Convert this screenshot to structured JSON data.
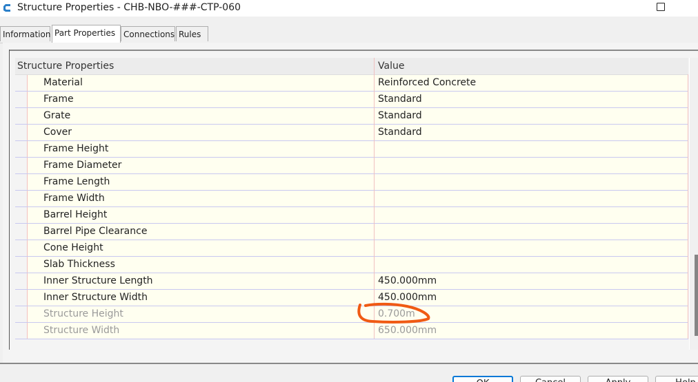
{
  "window": {
    "title": "Structure Properties - CHB-NBO-###-CTP-060"
  },
  "tabs": [
    {
      "label": "Information",
      "active": false
    },
    {
      "label": "Part Properties",
      "active": true
    },
    {
      "label": "Connections",
      "active": false
    },
    {
      "label": "Rules",
      "active": false
    }
  ],
  "grid": {
    "headers": [
      "Structure Properties",
      "Value"
    ],
    "rows": [
      {
        "name": "Material",
        "value": "Reinforced Concrete",
        "disabled": false
      },
      {
        "name": "Frame",
        "value": "Standard",
        "disabled": false
      },
      {
        "name": "Grate",
        "value": "Standard",
        "disabled": false
      },
      {
        "name": "Cover",
        "value": "Standard",
        "disabled": false
      },
      {
        "name": "Frame Height",
        "value": "",
        "disabled": false
      },
      {
        "name": "Frame Diameter",
        "value": "",
        "disabled": false
      },
      {
        "name": "Frame Length",
        "value": "",
        "disabled": false
      },
      {
        "name": "Frame Width",
        "value": "",
        "disabled": false
      },
      {
        "name": "Barrel Height",
        "value": "",
        "disabled": false
      },
      {
        "name": "Barrel Pipe Clearance",
        "value": "",
        "disabled": false
      },
      {
        "name": "Cone Height",
        "value": "",
        "disabled": false
      },
      {
        "name": "Slab Thickness",
        "value": "",
        "disabled": false
      },
      {
        "name": "Inner Structure Length",
        "value": "450.000mm",
        "disabled": false
      },
      {
        "name": "Inner Structure Width",
        "value": "450.000mm",
        "disabled": false
      },
      {
        "name": "Structure Height",
        "value": "0.700m",
        "disabled": true
      },
      {
        "name": "Structure Width",
        "value": "650.000mm",
        "disabled": true
      }
    ]
  },
  "buttons": {
    "ok": "OK",
    "cancel": "Cancel",
    "apply": "Apply",
    "help": "Help"
  },
  "colors": {
    "annotation": "#f05a14",
    "row_bg": "#fffff0",
    "accent": "#0078d7"
  }
}
